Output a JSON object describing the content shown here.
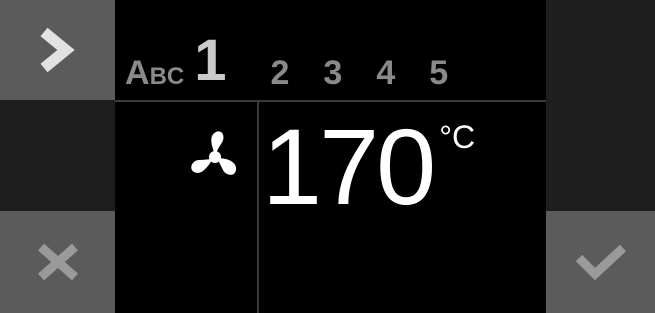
{
  "header": {
    "mode_label": "Abc",
    "steps": [
      {
        "label": "1",
        "current": true
      },
      {
        "label": "2",
        "current": false
      },
      {
        "label": "3",
        "current": false
      },
      {
        "label": "4",
        "current": false
      },
      {
        "label": "5",
        "current": false
      }
    ]
  },
  "main": {
    "mode_icon": "fan-icon",
    "temperature": {
      "value": "170",
      "unit": "°C"
    }
  },
  "buttons": {
    "next": "chevron-right-icon",
    "cancel": "x-icon",
    "confirm": "checkmark-icon"
  },
  "colors": {
    "button_bg": "#5b5b5b",
    "side_bg": "#1e1e1e",
    "screen_bg": "#000000",
    "active_text": "#ffffff",
    "inactive_text": "#8a8a8a"
  }
}
